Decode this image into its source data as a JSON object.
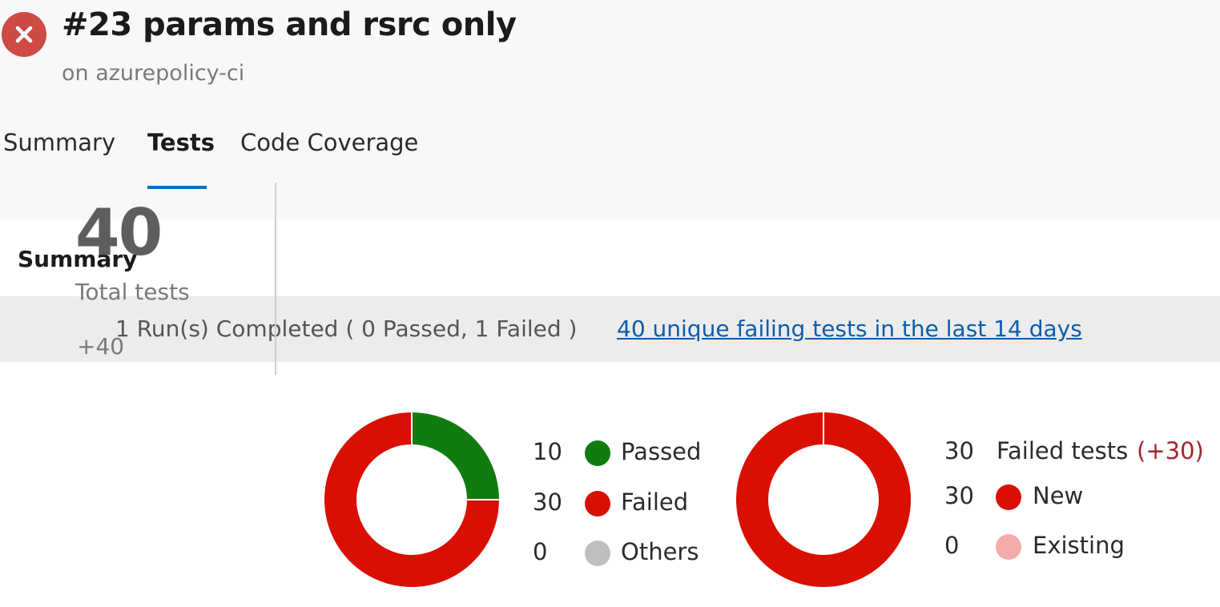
{
  "header": {
    "title": "#23 params and rsrc only",
    "subtitle": "on azurepolicy-ci",
    "status_icon": "close-icon",
    "status_color": "#cd4a45"
  },
  "tabs": [
    {
      "label": "Summary",
      "active": false
    },
    {
      "label": "Tests",
      "active": true
    },
    {
      "label": "Code Coverage",
      "active": false
    }
  ],
  "summary": {
    "title": "Summary",
    "run_status": "1 Run(s) Completed ( 0 Passed, 1 Failed )",
    "failing_link": "40 unique failing tests in the last 14 days",
    "total": {
      "value": "40",
      "label": "Total tests",
      "delta": "+40"
    },
    "outcome": {
      "colors": {
        "passed": "#107c10",
        "failed": "#d90f02",
        "others": "#bfbfbf"
      },
      "items": [
        {
          "count": "10",
          "label": "Passed",
          "value": 10
        },
        {
          "count": "30",
          "label": "Failed",
          "value": 30
        },
        {
          "count": "0",
          "label": "Others",
          "value": 0
        }
      ]
    },
    "failures": {
      "colors": {
        "new": "#d90f02",
        "existing": "#f4abaa",
        "delta": "#a4262c"
      },
      "header": {
        "count": "30",
        "label": "Failed tests",
        "delta": "(+30)"
      },
      "items": [
        {
          "count": "30",
          "label": "New",
          "value": 30
        },
        {
          "count": "0",
          "label": "Existing",
          "value": 0
        }
      ]
    }
  }
}
